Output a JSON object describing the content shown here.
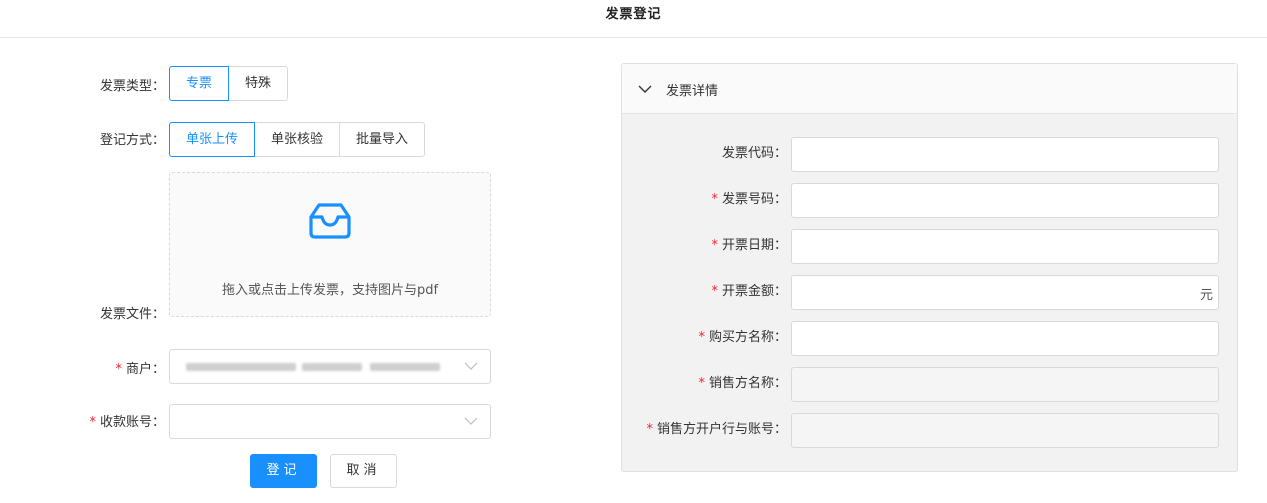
{
  "header": {
    "title": "发票登记"
  },
  "form": {
    "invoice_type": {
      "label": "发票类型：",
      "options": [
        "专票",
        "特殊"
      ],
      "selected": 0
    },
    "register_method": {
      "label": "登记方式：",
      "options": [
        "单张上传",
        "单张核验",
        "批量导入"
      ],
      "selected": 0
    },
    "invoice_file": {
      "label": "发票文件：",
      "upload_hint": "拖入或点击上传发票，支持图片与pdf",
      "icon": "inbox-icon"
    },
    "merchant": {
      "required_mark": "*",
      "label": "商户：",
      "value": ""
    },
    "payee_account": {
      "required_mark": "*",
      "label": "收款账号：",
      "value": ""
    },
    "actions": {
      "submit": "登记",
      "cancel": "取消"
    }
  },
  "details": {
    "title": "发票详情",
    "fields": [
      {
        "required": false,
        "mark": "",
        "label": "发票代码：",
        "value": "",
        "suffix": "",
        "disabled": false
      },
      {
        "required": true,
        "mark": "*",
        "label": "发票号码：",
        "value": "",
        "suffix": "",
        "disabled": false
      },
      {
        "required": true,
        "mark": "*",
        "label": "开票日期：",
        "value": "",
        "suffix": "",
        "disabled": false
      },
      {
        "required": true,
        "mark": "*",
        "label": "开票金额：",
        "value": "",
        "suffix": "元",
        "disabled": false
      },
      {
        "required": true,
        "mark": "*",
        "label": "购买方名称：",
        "value": "",
        "suffix": "",
        "disabled": false
      },
      {
        "required": true,
        "mark": "*",
        "label": "销售方名称：",
        "value": "",
        "suffix": "",
        "disabled": true
      },
      {
        "required": true,
        "mark": "*",
        "label": "销售方开户行与账号：",
        "value": "",
        "suffix": "",
        "disabled": true
      }
    ]
  },
  "colors": {
    "primary": "#1890ff",
    "required": "#f5222d",
    "panel_bg": "#f2f2f2"
  }
}
